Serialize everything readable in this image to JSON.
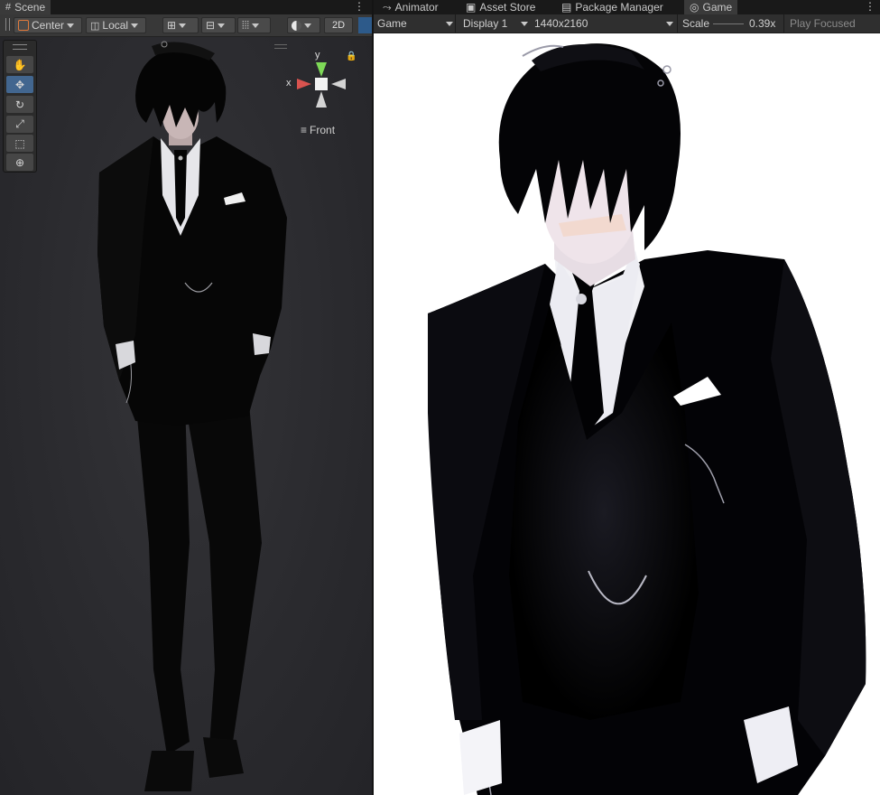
{
  "scene": {
    "tab": "Scene",
    "pivot_mode": "Center",
    "pivot_rotation": "Local",
    "mode_2d": "2D",
    "gizmo": {
      "y_label": "y",
      "x_label": "x",
      "view_label": "Front"
    }
  },
  "tabs_right": {
    "animator": "Animator",
    "asset_store": "Asset Store",
    "package_manager": "Package Manager",
    "game": "Game"
  },
  "game": {
    "mode": "Game",
    "display": "Display 1",
    "resolution": "1440x2160",
    "scale_label": "Scale",
    "scale_value": "0.39x",
    "play_mode": "Play Focused"
  },
  "colors": {
    "editor_bg": "#383838",
    "tab_bg": "#191919",
    "selected_tool": "#42668f",
    "gizmo_x": "#d9534f",
    "gizmo_y": "#7ed957"
  }
}
